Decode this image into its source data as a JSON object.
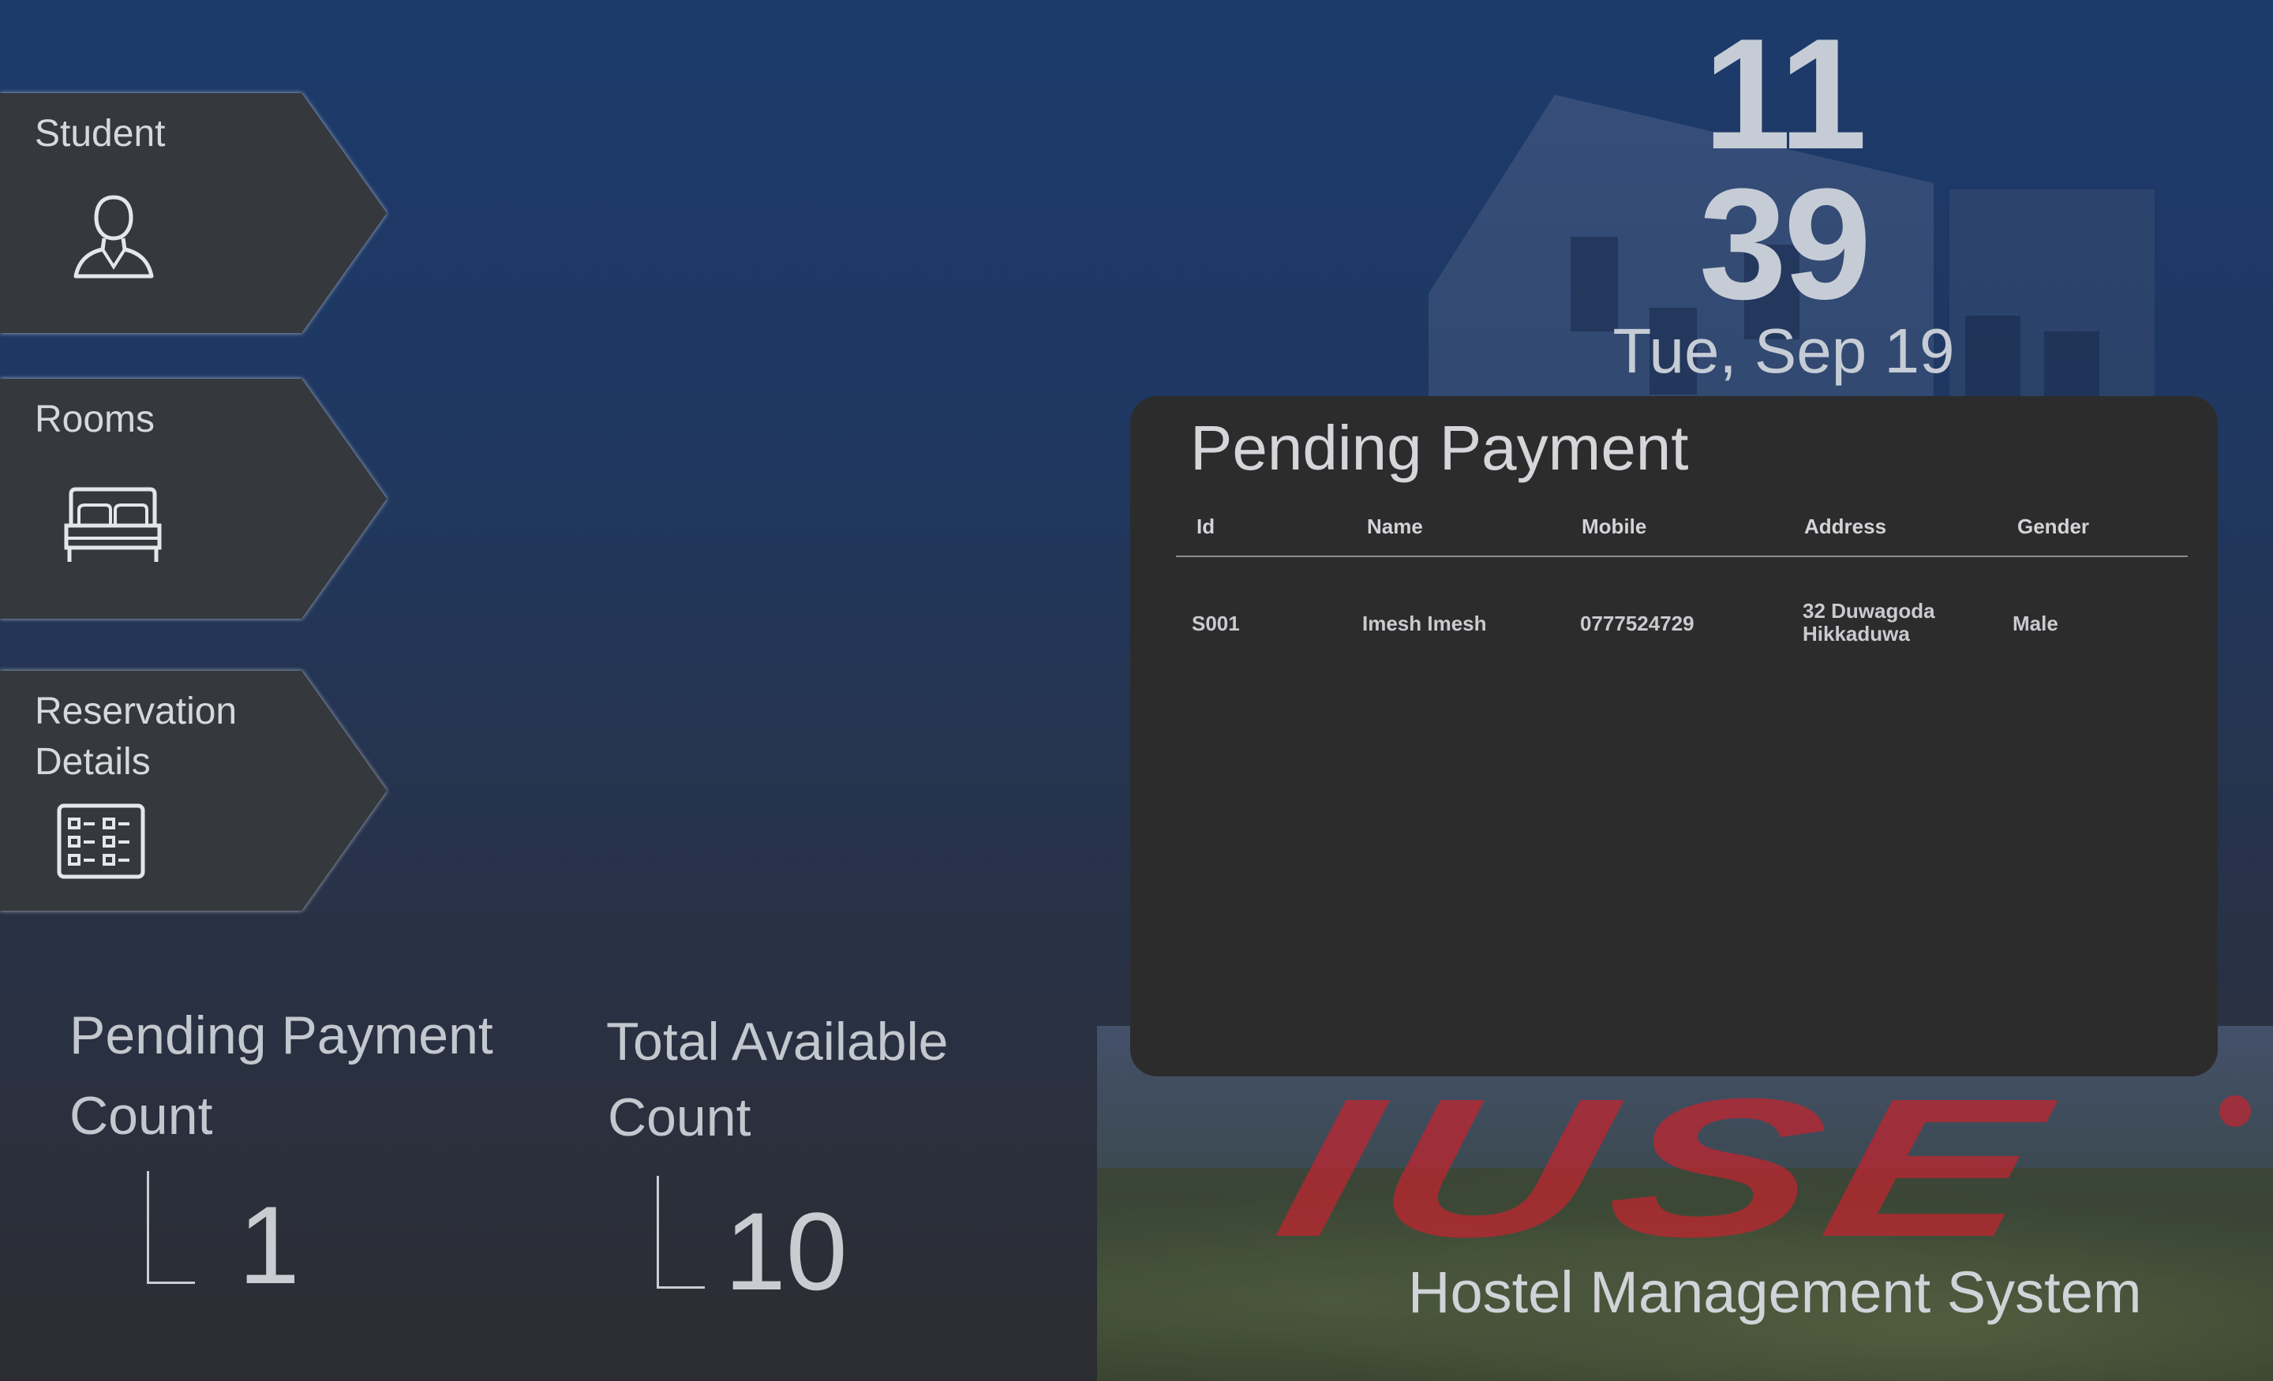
{
  "nav": {
    "student_label": "Student",
    "rooms_label": "Rooms",
    "reservation_label": "Reservation Details"
  },
  "clock": {
    "hour": "11",
    "minute": "39",
    "date": "Tue, Sep 19"
  },
  "pending_panel": {
    "title": "Pending Payment",
    "columns": [
      "Id",
      "Name",
      "Mobile",
      "Address",
      "Gender"
    ],
    "rows": [
      {
        "id": "S001",
        "name": "Imesh Imesh",
        "mobile": "0777524729",
        "address_line1": "32 Duwagoda",
        "address_line2": "Hikkaduwa",
        "gender": "Male"
      }
    ]
  },
  "stats": {
    "pending_title_line1": "Pending Payment",
    "pending_title_line2": "Count",
    "pending_value": "1",
    "available_title_line1": "Total Available",
    "available_title_line2": "Count",
    "available_value": "10"
  },
  "branding": {
    "logo_text": "IUSE",
    "subtitle": "Hostel Management System",
    "logo_color": "#c4242f"
  },
  "icons": {
    "student": "person-outline-icon",
    "rooms": "bed-icon",
    "reservation": "list-details-icon"
  }
}
